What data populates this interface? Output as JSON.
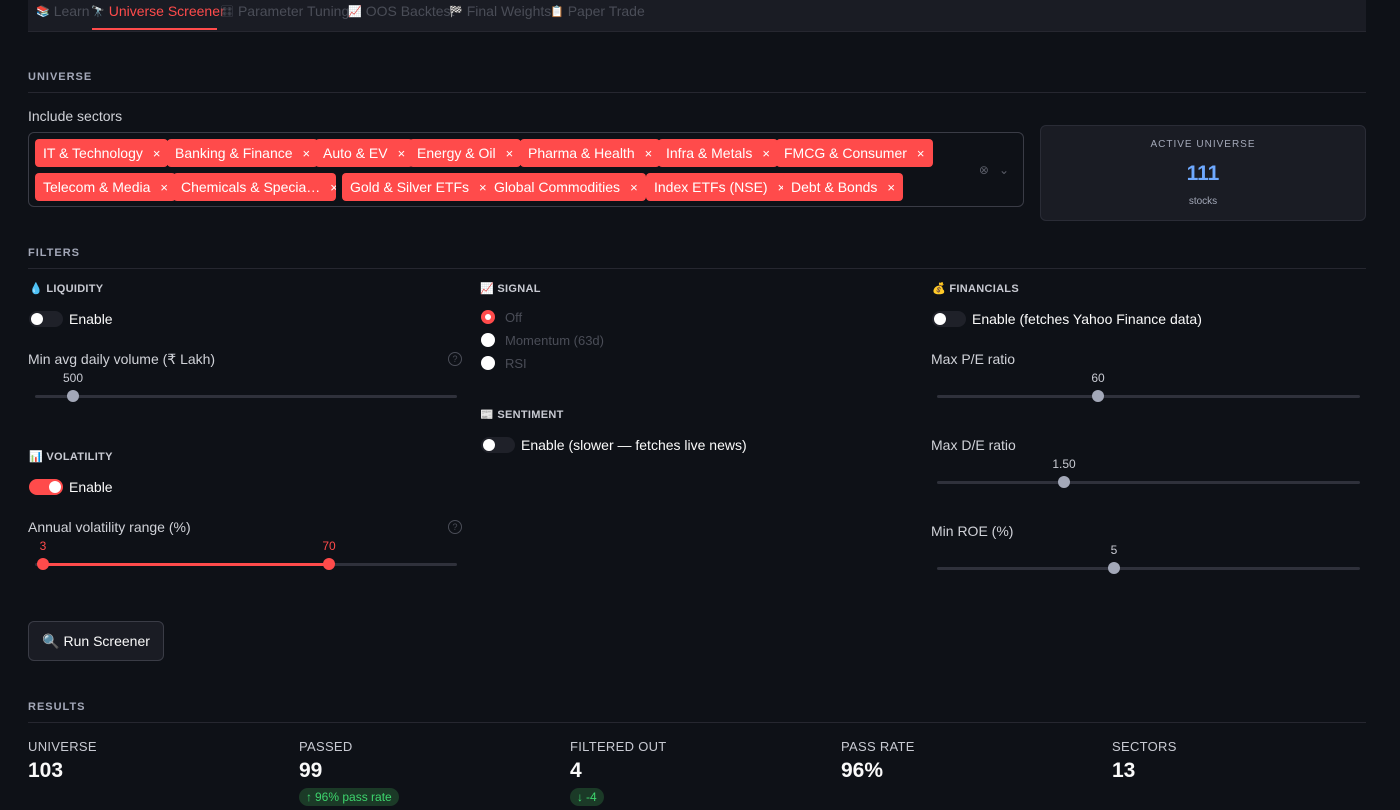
{
  "tabs": [
    {
      "icon": "📚",
      "label": "Learn"
    },
    {
      "icon": "🔭",
      "label": "Universe Screener"
    },
    {
      "icon": "🎛",
      "label": "Parameter Tuning"
    },
    {
      "icon": "📈",
      "label": "OOS Backtest"
    },
    {
      "icon": "🏁",
      "label": "Final Weights"
    },
    {
      "icon": "📋",
      "label": "Paper Trade"
    }
  ],
  "universe": {
    "heading": "UNIVERSE",
    "include_label": "Include sectors",
    "chips_row1": [
      "IT & Technology",
      "Banking & Finance",
      "Auto & EV",
      "Energy & Oil",
      "Pharma & Health",
      "Infra & Metals",
      "FMCG & Consumer"
    ],
    "chips_row2": [
      "Telecom & Media",
      "Chemicals & Specia…",
      "Gold & Silver ETFs",
      "Global Commodities",
      "Index ETFs (NSE)",
      "Debt & Bonds"
    ],
    "chip_remove": "×",
    "active": {
      "label": "ACTIVE UNIVERSE",
      "value": "111",
      "sub": "stocks"
    }
  },
  "filters": {
    "heading": "FILTERS",
    "liquidity": {
      "icon": "💧",
      "title": "LIQUIDITY",
      "toggle_label": "Enable",
      "enabled": false,
      "slider_label": "Min avg daily volume (₹ Lakh)",
      "value": "500"
    },
    "volatility": {
      "icon": "📊",
      "title": "VOLATILITY",
      "toggle_label": "Enable",
      "enabled": true,
      "slider_label": "Annual volatility range (%)",
      "low": "3",
      "high": "70"
    },
    "signal": {
      "icon": "📈",
      "title": "SIGNAL",
      "options": [
        "Off",
        "Momentum (63d)",
        "RSI"
      ],
      "selected": "Off"
    },
    "sentiment": {
      "icon": "📰",
      "title": "SENTIMENT",
      "toggle_label": "Enable (slower — fetches live news)",
      "enabled": false
    },
    "financials": {
      "icon": "💰",
      "title": "FINANCIALS",
      "toggle_label": "Enable (fetches Yahoo Finance data)",
      "enabled": false,
      "pe_label": "Max P/E ratio",
      "pe_value": "60",
      "de_label": "Max D/E ratio",
      "de_value": "1.50",
      "roe_label": "Min ROE (%)",
      "roe_value": "5"
    }
  },
  "run_button": {
    "icon": "🔍",
    "label": "Run Screener"
  },
  "results": {
    "heading": "RESULTS",
    "metrics": [
      {
        "label": "UNIVERSE",
        "value": "103"
      },
      {
        "label": "PASSED",
        "value": "99",
        "delta": "96% pass rate",
        "delta_dir": "↑"
      },
      {
        "label": "FILTERED OUT",
        "value": "4",
        "delta": "-4",
        "delta_dir": "↓"
      },
      {
        "label": "PASS RATE",
        "value": "96%"
      },
      {
        "label": "SECTORS",
        "value": "13"
      }
    ]
  },
  "colors": {
    "accent": "#ff4b4b",
    "background": "#0e1117",
    "active_value": "#6ea8fe",
    "delta_green": "#3dd56d"
  }
}
